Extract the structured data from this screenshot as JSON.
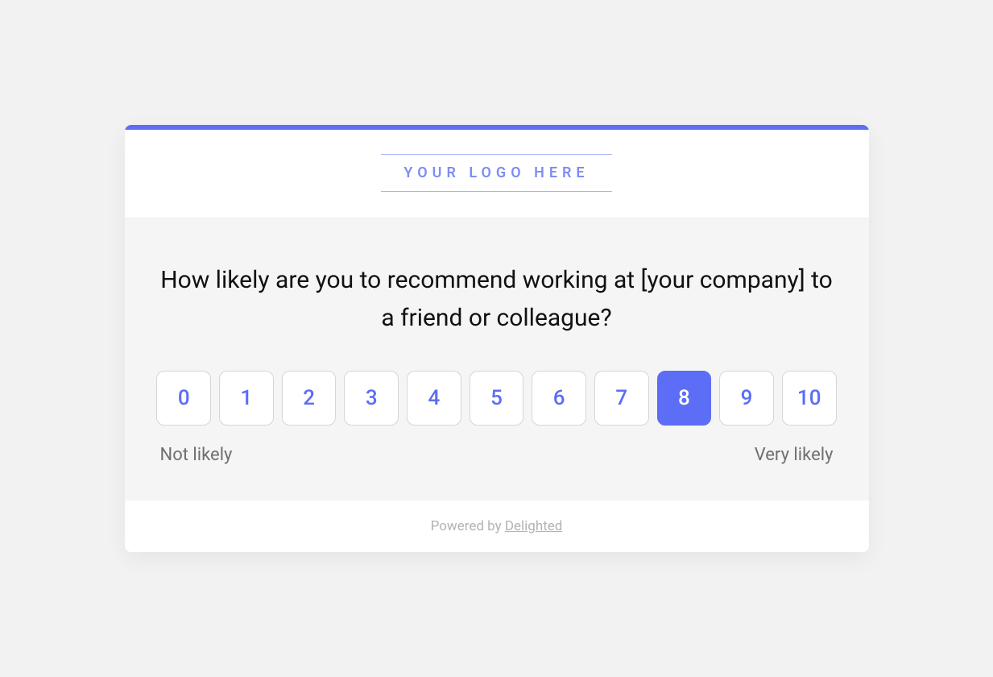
{
  "accent_color": "#5b6ef5",
  "logo": {
    "placeholder_text": "YOUR LOGO HERE"
  },
  "question": "How likely are you to recommend working at [your company] to a friend or colleague?",
  "rating": {
    "options": [
      "0",
      "1",
      "2",
      "3",
      "4",
      "5",
      "6",
      "7",
      "8",
      "9",
      "10"
    ],
    "selected": "8",
    "low_label": "Not likely",
    "high_label": "Very likely"
  },
  "footer": {
    "prefix": "Powered by ",
    "link_text": "Delighted"
  }
}
